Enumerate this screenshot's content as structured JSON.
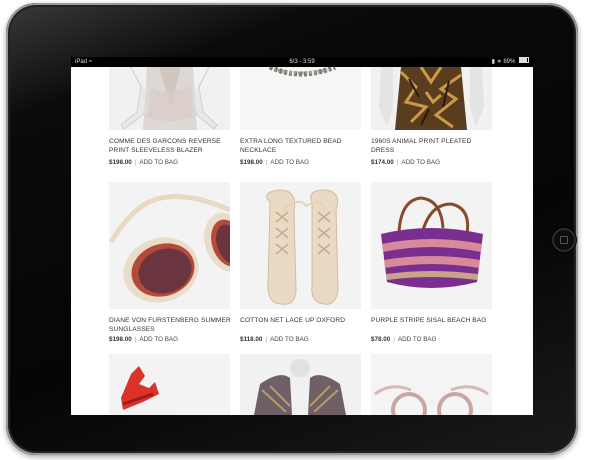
{
  "status_bar": {
    "device": "iPad",
    "center": "6/3 - 3:59",
    "battery": "89%"
  },
  "products": [
    {
      "name": "COMME DES GARCONS REVERSE PRINT SLEEVELESS BLAZER",
      "price": "$198.00",
      "action": "ADD TO BAG"
    },
    {
      "name": "EXTRA LONG TEXTURED BEAD NECKLACE",
      "price": "$198.00",
      "action": "ADD TO BAG"
    },
    {
      "name": "1960S ANIMAL PRINT PLEATED DRESS",
      "price": "$174.00",
      "action": "ADD TO BAG"
    },
    {
      "name": "DIANE VON FURSTENBERG SUMMER SUNGLASSES",
      "price": "$198.00",
      "action": "ADD TO BAG"
    },
    {
      "name": "COTTON NET LACE UP OXFORD",
      "price": "$118.00",
      "action": "ADD TO BAG"
    },
    {
      "name": "PURPLE STRIPE SISAL BEACH BAG",
      "price": "$78.00",
      "action": "ADD TO BAG"
    }
  ],
  "colors": {
    "bezel": "#050505",
    "screen_bg": "#ffffff",
    "text": "#333333",
    "bag_purple": "#7a2f8f",
    "bag_pink": "#d88a9a"
  }
}
